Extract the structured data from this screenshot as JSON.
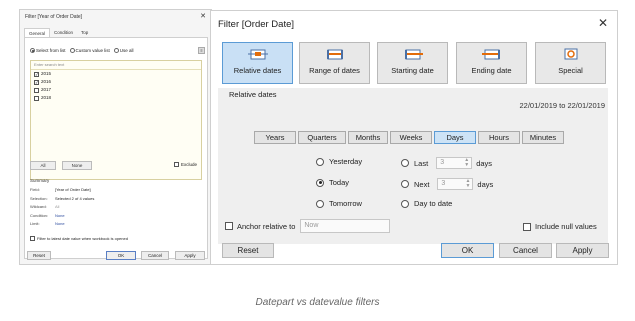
{
  "left_dialog": {
    "title": "Filter [Year of Order Date]",
    "close": "✕",
    "tabs": [
      "General",
      "Condition",
      "Top"
    ],
    "radio_options": [
      "Select from list",
      "Custom value list",
      "Use all"
    ],
    "search_placeholder": "Enter search text",
    "items": [
      {
        "label": "2015",
        "checked": true
      },
      {
        "label": "2016",
        "checked": true
      },
      {
        "label": "2017",
        "checked": false
      },
      {
        "label": "2018",
        "checked": false
      }
    ],
    "all_button": "All",
    "none_button": "None",
    "exclude_label": "Exclude",
    "summary_heading": "Summary",
    "summary": [
      {
        "key": "Field:",
        "value": "[Year of Order Date]"
      },
      {
        "key": "Selection:",
        "value": "Selected 2 of 4 values"
      },
      {
        "key": "Wildcard:",
        "value": "All"
      },
      {
        "key": "Condition:",
        "value": "None"
      },
      {
        "key": "Limit:",
        "value": "None"
      }
    ],
    "filter_latest_label": "Filter to latest date value when workbook is opened",
    "reset_button": "Reset",
    "ok_button": "OK",
    "cancel_button": "Cancel",
    "apply_button": "Apply"
  },
  "right_dialog": {
    "title": "Filter [Order Date]",
    "close": "✕",
    "type_buttons": [
      "Relative dates",
      "Range of dates",
      "Starting date",
      "Ending date",
      "Special"
    ],
    "active_type": "Relative dates",
    "section_label": "Relative dates",
    "date_range": "22/01/2019 to 22/01/2019",
    "units": [
      "Years",
      "Quarters",
      "Months",
      "Weeks",
      "Days",
      "Hours",
      "Minutes"
    ],
    "active_unit": "Days",
    "options": {
      "yesterday": "Yesterday",
      "today": "Today",
      "tomorrow": "Tomorrow",
      "last": "Last",
      "next": "Next",
      "day_to_date": "Day to date",
      "last_value": "3",
      "next_value": "3",
      "days_suffix": "days"
    },
    "selected_option": "Today",
    "anchor_label": "Anchor relative to",
    "anchor_value": "Now",
    "include_null_label": "Include null values",
    "reset_button": "Reset",
    "ok_button": "OK",
    "cancel_button": "Cancel",
    "apply_button": "Apply"
  },
  "caption": "Datepart vs datevalue filters",
  "colors": {
    "active_fill": "#c9e0f5",
    "active_border": "#5b9bd5",
    "panel_bg": "#efefef"
  }
}
